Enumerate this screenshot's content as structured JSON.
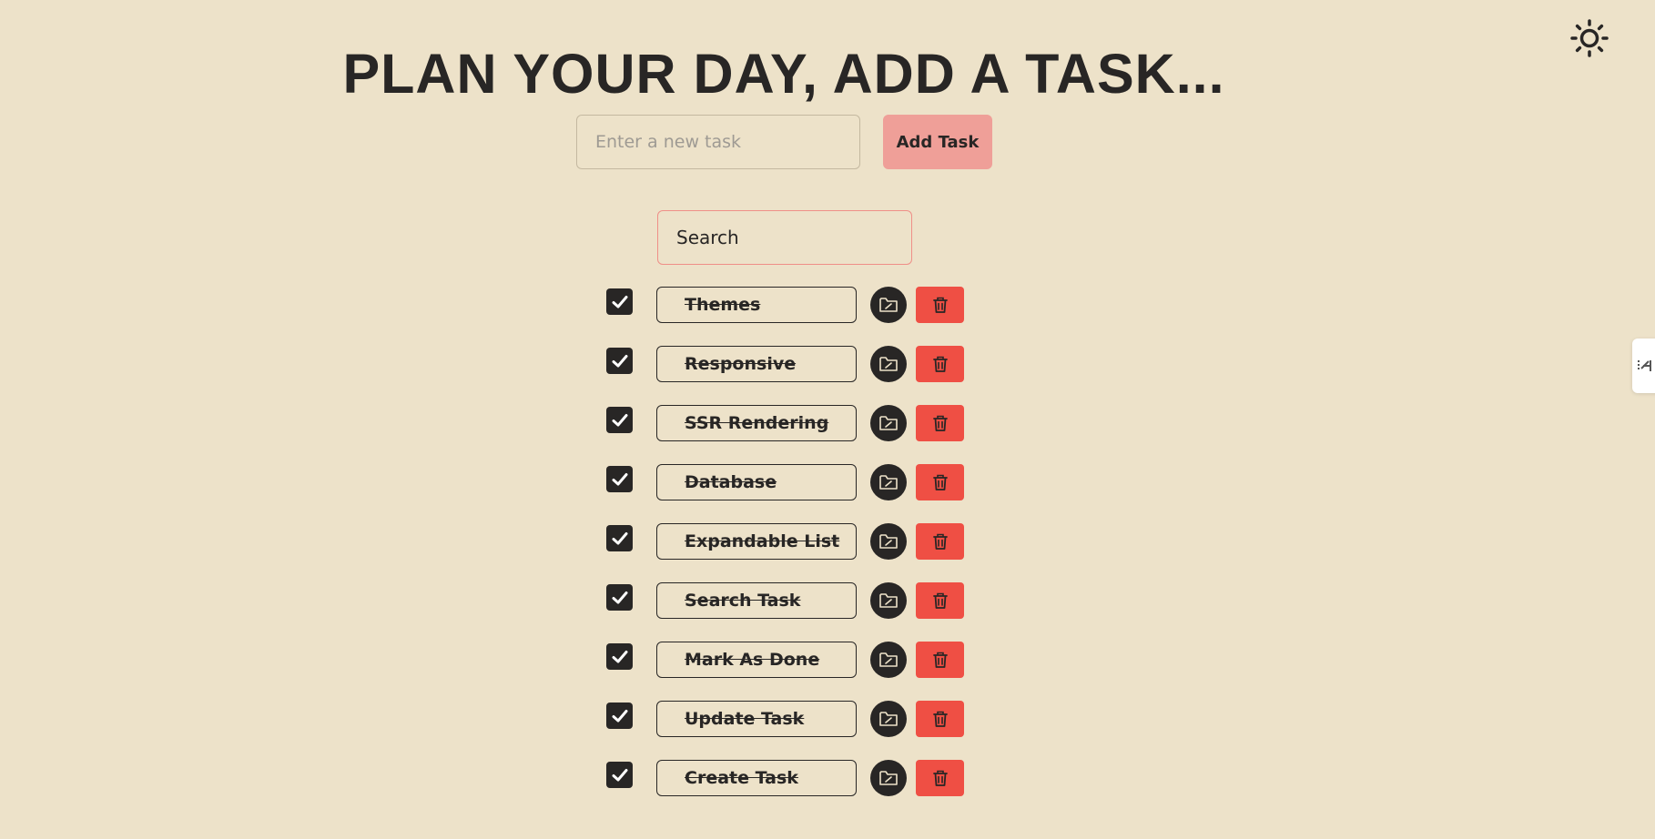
{
  "header": {
    "title": "PLAN YOUR DAY, ADD A TASK..."
  },
  "new_task": {
    "placeholder": "Enter a new task",
    "value": "",
    "button_label": "Add Task"
  },
  "search": {
    "placeholder": "Search",
    "value": ""
  },
  "theme_toggle": {
    "icon": "sun-icon"
  },
  "side_tab": {
    "icon": "side-panel-icon"
  },
  "colors": {
    "background": "#ede2c9",
    "text": "#282625",
    "add_button": "#ef9f98",
    "search_border": "#ef8f88",
    "delete_button": "#ef4f44",
    "edit_button": "#282625"
  },
  "tasks": [
    {
      "label": "Themes",
      "done": true
    },
    {
      "label": "Responsive",
      "done": true
    },
    {
      "label": "SSR Rendering",
      "done": true
    },
    {
      "label": "Database",
      "done": true
    },
    {
      "label": "Expandable List",
      "done": true
    },
    {
      "label": "Search Task",
      "done": true
    },
    {
      "label": "Mark As Done",
      "done": true
    },
    {
      "label": "Update Task",
      "done": true
    },
    {
      "label": "Create Task",
      "done": true
    }
  ],
  "task_icons": {
    "checkbox": "check-icon",
    "edit": "folder-edit-icon",
    "delete": "trash-icon"
  }
}
